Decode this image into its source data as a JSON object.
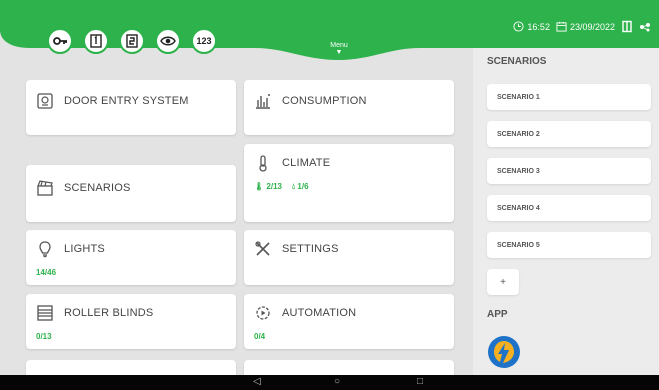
{
  "header": {
    "menu_label": "Menu",
    "quick_icons": [
      "key-icon",
      "page-1-icon",
      "page-2-icon",
      "eye-icon",
      "keypad-icon"
    ],
    "keypad_text": "123",
    "time": "16:52",
    "date": "23/09/2022",
    "color": "#2db24c"
  },
  "cards": {
    "door_entry": {
      "label": "DOOR ENTRY SYSTEM",
      "icon": "intercom-icon"
    },
    "consumption": {
      "label": "CONSUMPTION",
      "icon": "bar-chart-icon"
    },
    "climate": {
      "label": "CLIMATE",
      "icon": "thermometer-icon",
      "stat1": "2/13",
      "stat2": "1/6"
    },
    "scenarios": {
      "label": "SCENARIOS",
      "icon": "clapperboard-icon"
    },
    "lights": {
      "label": "LIGHTS",
      "icon": "bulb-icon",
      "stat": "14/46"
    },
    "settings": {
      "label": "SETTINGS",
      "icon": "tools-icon"
    },
    "roller_blinds": {
      "label": "ROLLER BLINDS",
      "icon": "blinds-icon",
      "stat": "0/13"
    },
    "automation": {
      "label": "AUTOMATION",
      "icon": "automation-gear-icon",
      "stat": "0/4"
    }
  },
  "sidebar": {
    "scenarios_title": "SCENARIOS",
    "scenarios": [
      "SCENARIO 1",
      "SCENARIO 2",
      "SCENARIO 3",
      "SCENARIO 4",
      "SCENARIO 5"
    ],
    "add_label": "+",
    "app_title": "APP"
  },
  "navbar": {
    "back": "◁",
    "home": "○",
    "recent": "□"
  }
}
